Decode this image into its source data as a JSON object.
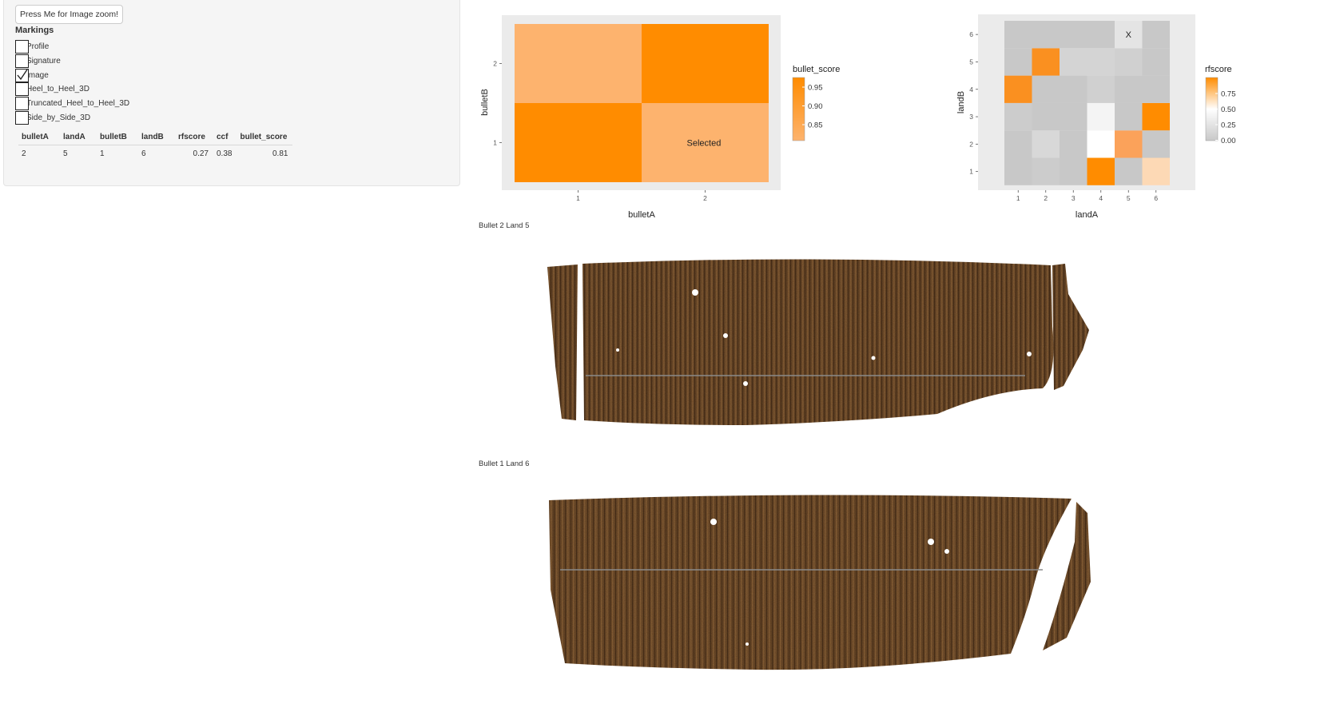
{
  "controls": {
    "zoom_button": "Press Me for Image zoom!",
    "markings_title": "Markings",
    "markings": [
      {
        "label": "Profile",
        "checked": false
      },
      {
        "label": "Signature",
        "checked": false
      },
      {
        "label": "Image",
        "checked": true
      },
      {
        "label": "Heel_to_Heel_3D",
        "checked": false
      },
      {
        "label": "Truncated_Heel_to_Heel_3D",
        "checked": false
      },
      {
        "label": "Side_by_Side_3D",
        "checked": false
      }
    ]
  },
  "table": {
    "headers": [
      "bulletA",
      "landA",
      "bulletB",
      "landB",
      "rfscore",
      "ccf",
      "bullet_score"
    ],
    "rows": [
      [
        "2",
        "5",
        "1",
        "6",
        "0.27",
        "0.38",
        "0.81"
      ]
    ]
  },
  "chart_data": [
    {
      "type": "heatmap",
      "xlabel": "bulletA",
      "ylabel": "bulletB",
      "x_categories": [
        "1",
        "2"
      ],
      "y_categories": [
        "1",
        "2"
      ],
      "legend_title": "bullet_score",
      "legend_ticks": [
        "0.95",
        "0.90",
        "0.85"
      ],
      "color_low": "#fdb36e",
      "color_high": "#ff8c00",
      "cells": [
        {
          "x": "1",
          "y": "1",
          "color": "#ff8c00"
        },
        {
          "x": "2",
          "y": "1",
          "color": "#fdb36e",
          "label": "Selected"
        },
        {
          "x": "1",
          "y": "2",
          "color": "#fdb36e"
        },
        {
          "x": "2",
          "y": "2",
          "color": "#ff8c00"
        }
      ]
    },
    {
      "type": "heatmap",
      "xlabel": "landA",
      "ylabel": "landB",
      "x_categories": [
        "1",
        "2",
        "3",
        "4",
        "5",
        "6"
      ],
      "y_categories": [
        "1",
        "2",
        "3",
        "4",
        "5",
        "6"
      ],
      "legend_title": "rfscore",
      "legend_ticks": [
        "0.75",
        "0.50",
        "0.25",
        "0.00"
      ],
      "color_low": "#c8c8c8",
      "color_mid": "#ffffff",
      "color_high": "#ff8c00",
      "marker": {
        "x": "5",
        "y": "6",
        "text": "X"
      },
      "grid_colors": [
        [
          "#c8c8c8",
          "#cccccc",
          "#c8c8c8",
          "#ff8c00",
          "#c8c8c8",
          "#fdd9b5"
        ],
        [
          "#c8c8c8",
          "#d8d8d8",
          "#c8c8c8",
          "#ffffff",
          "#fba25a",
          "#c8c8c8"
        ],
        [
          "#cccccc",
          "#c8c8c8",
          "#c8c8c8",
          "#f4f4f4",
          "#c8c8c8",
          "#ff8c00"
        ],
        [
          "#fa9020",
          "#c8c8c8",
          "#c8c8c8",
          "#d0d0d0",
          "#c8c8c8",
          "#c8c8c8"
        ],
        [
          "#c8c8c8",
          "#fa9020",
          "#d4d4d4",
          "#d4d4d4",
          "#d0d0d0",
          "#c8c8c8"
        ],
        [
          "#c8c8c8",
          "#c8c8c8",
          "#c8c8c8",
          "#c8c8c8",
          "#e4e4e4",
          "#c8c8c8"
        ]
      ]
    }
  ],
  "images": [
    {
      "label": "Bullet 2 Land 5",
      "alt": "bullet land surface scan"
    },
    {
      "label": "Bullet 1 Land 6",
      "alt": "bullet land surface scan"
    }
  ]
}
